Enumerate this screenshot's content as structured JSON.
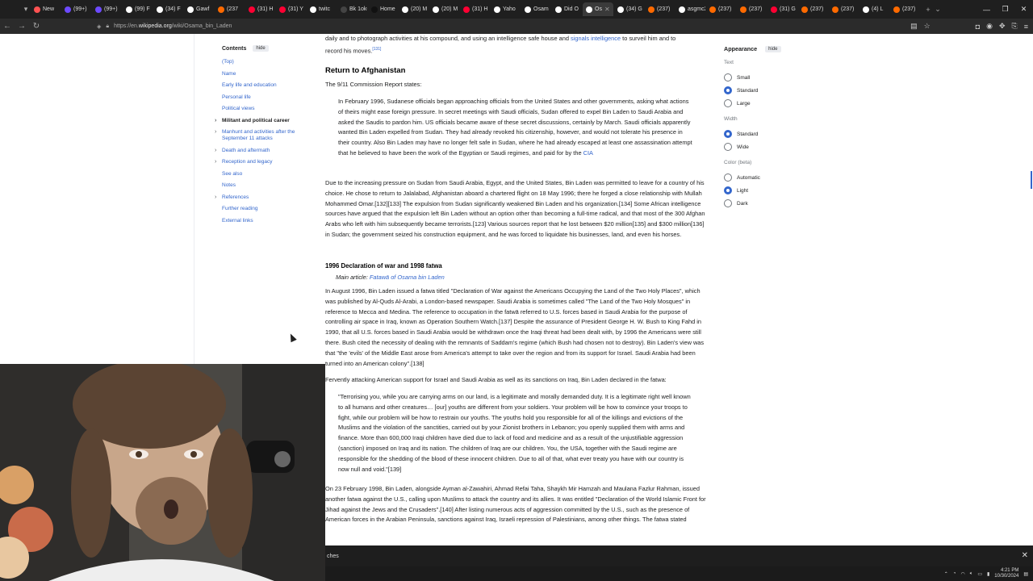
{
  "browser": {
    "tabs": [
      {
        "label": "New",
        "color": "#ff5252"
      },
      {
        "label": "(99+)",
        "color": "#6d4aff"
      },
      {
        "label": "(99+)",
        "color": "#6d4aff"
      },
      {
        "label": "(99) F",
        "color": "#ffffff"
      },
      {
        "label": "(34) F",
        "color": "#ffffff"
      },
      {
        "label": "Gawf",
        "color": "#ffffff"
      },
      {
        "label": "(237",
        "color": "#ff6a00"
      },
      {
        "label": "(31) H",
        "color": "#ff0033"
      },
      {
        "label": "(31) Y",
        "color": "#ff0033"
      },
      {
        "label": "twitc",
        "color": "#ffffff"
      },
      {
        "label": "Bk 1ok6",
        "color": "#444444"
      },
      {
        "label": "Home",
        "color": "#111111"
      },
      {
        "label": "(20) M",
        "color": "#ffffff"
      },
      {
        "label": "(20) M",
        "color": "#ffffff"
      },
      {
        "label": "(31) H",
        "color": "#ff0033"
      },
      {
        "label": "Yaho",
        "color": "#ffffff"
      },
      {
        "label": "Osam",
        "color": "#ffffff"
      },
      {
        "label": "Did O",
        "color": "#ffffff"
      },
      {
        "label": "Os",
        "color": "#ffffff",
        "active": true
      },
      {
        "label": "(34) G",
        "color": "#ffffff"
      },
      {
        "label": "(237)",
        "color": "#ff6a00"
      },
      {
        "label": "asgmc2n",
        "color": "#ffffff"
      },
      {
        "label": "(237)",
        "color": "#ff6a00"
      },
      {
        "label": "(237)",
        "color": "#ff6a00"
      },
      {
        "label": "(31) G",
        "color": "#ff0033"
      },
      {
        "label": "(237)",
        "color": "#ff6a00"
      },
      {
        "label": "(237)",
        "color": "#ff6a00"
      },
      {
        "label": "(4) L",
        "color": "#ffffff"
      },
      {
        "label": "(237)",
        "color": "#ff6a00"
      }
    ],
    "url_prefix": "https://en.",
    "url_domain": "wikipedia.org",
    "url_path": "/wiki/Osama_bin_Laden"
  },
  "toc": {
    "title": "Contents",
    "hide": "hide",
    "items": [
      {
        "label": "(Top)"
      },
      {
        "label": "Name"
      },
      {
        "label": "Early life and education"
      },
      {
        "label": "Personal life"
      },
      {
        "label": "Political views"
      },
      {
        "label": "Militant and political career",
        "bold": true,
        "expand": true
      },
      {
        "label": "Manhunt and activities after the September 11 attacks",
        "expand": true
      },
      {
        "label": "Death and aftermath",
        "expand": true
      },
      {
        "label": "Reception and legacy",
        "expand": true
      },
      {
        "label": "See also"
      },
      {
        "label": "Notes"
      },
      {
        "label": "References",
        "expand": true
      },
      {
        "label": "Further reading"
      },
      {
        "label": "External links"
      }
    ]
  },
  "article": {
    "top_line1": "daily and to photograph activities at his compound, and using an intelligence safe house and ",
    "top_link": "signals intelligence",
    "top_line1b": " to surveil him and to",
    "top_line2": "record his moves.",
    "top_ref": "[131]",
    "h_return": "Return to Afghanistan",
    "commission": "The 9/11 Commission Report states:",
    "quote1": "In February 1996, Sudanese officials began approaching officials from the United States and other governments, asking what actions of theirs might ease foreign pressure. In secret meetings with Saudi officials, Sudan offered to expel Bin Laden to Saudi Arabia and asked the Saudis to pardon him. US officials became aware of these secret discussions, certainly by March. Saudi officials apparently wanted Bin Laden expelled from Sudan. They had already revoked his citizenship, however, and would not tolerate his presence in their country. Also Bin Laden may have no longer felt safe in Sudan, where he had already escaped at least one assassination attempt that he believed to have been the work of the Egyptian or Saudi regimes, and paid for by the ",
    "quote1_link": "CIA",
    "para1": "Due to the increasing pressure on Sudan from Saudi Arabia, Egypt, and the United States, Bin Laden was permitted to leave for a country of his choice. He chose to return to Jalalabad, Afghanistan aboard a chartered flight on 18 May 1996; there he forged a close relationship with Mullah Mohammed Omar.[132][133] The expulsion from Sudan significantly weakened Bin Laden and his organization.[134] Some African intelligence sources have argued that the expulsion left Bin Laden without an option other than becoming a full-time radical, and that most of the 300 Afghan Arabs who left with him subsequently became terrorists.[123] Various sources report that he lost between $20 million[135] and $300 million[136] in Sudan; the government seized his construction equipment, and he was forced to liquidate his businesses, land, and even his horses.",
    "h_fatwa": "1996 Declaration of war and 1998 fatwa",
    "main_article_prefix": "Main article: ",
    "main_article_link": "Fatawā of Osama bin Laden",
    "para2": "In August 1996, Bin Laden issued a fatwa titled \"Declaration of War against the Americans Occupying the Land of the Two Holy Places\", which was published by Al-Quds Al-Arabi, a London-based newspaper. Saudi Arabia is sometimes called \"The Land of the Two Holy Mosques\" in reference to Mecca and Medina. The reference to occupation in the fatwā referred to U.S. forces based in Saudi Arabia for the purpose of controlling air space in Iraq, known as Operation Southern Watch.[137] Despite the assurance of President George H. W. Bush to King Fahd in 1990, that all U.S. forces based in Saudi Arabia would be withdrawn once the Iraqi threat had been dealt with, by 1996 the Americans were still there. Bush cited the necessity of dealing with the remnants of Saddam's regime (which Bush had chosen not to destroy). Bin Laden's view was that \"the 'evils' of the Middle East arose from America's attempt to take over the region and from its support for Israel. Saudi Arabia had been turned into an American colony\".[138]",
    "para3": "Fervently attacking American support for Israel and Saudi Arabia as well as its sanctions on Iraq, Bin Laden declared in the fatwa:",
    "quote2": "\"Terrorising you, while you are carrying arms on our land, is a legitimate and morally demanded duty. It is a legitimate right well known to all humans and other creatures… [our] youths are different from your soldiers. Your problem will be how to convince your troops to fight, while our problem will be how to restrain our youths. The youths hold you responsible for all of the killings and evictions of the Muslims and the violation of the sanctities, carried out by your Zionist brothers in Lebanon; you openly supplied them with arms and finance. More than 600,000 Iraqi children have died due to lack of food and medicine and as a result of the unjustifiable aggression (sanction) imposed on Iraq and its nation. The children of Iraq are our children. You, the USA, together with the Saudi regime are responsible for the shedding of the blood of these innocent children. Due to all of that, what ever treaty you have with our country is now null and void.\"[139]",
    "para4": "On 23 February 1998, Bin Laden, alongside Ayman al-Zawahiri, Ahmad Refai Taha, Shaykh Mir Hamzah and Maulana Fazlur Rahman, issued another fatwa against the U.S., calling upon Muslims to attack the country and its allies. It was entitled \"Declaration of the World Islamic Front for Jihad against the Jews and the Crusaders\".[140] After listing numerous acts of aggression committed by the U.S., such as the presence of American forces in the Arabian Peninsula, sanctions against Iraq, Israeli repression of Palestinians, among other things. The fatwa stated"
  },
  "appearance": {
    "title": "Appearance",
    "hide": "hide",
    "text_label": "Text",
    "text_options": [
      "Small",
      "Standard",
      "Large"
    ],
    "text_selected": "Standard",
    "width_label": "Width",
    "width_options": [
      "Standard",
      "Wide"
    ],
    "width_selected": "Standard",
    "color_label": "Color (beta)",
    "color_options": [
      "Automatic",
      "Light",
      "Dark"
    ],
    "color_selected": "Light"
  },
  "findbar": {
    "text": "ches"
  },
  "taskbar": {
    "time": "4:21 PM",
    "date": "10/30/2024"
  }
}
